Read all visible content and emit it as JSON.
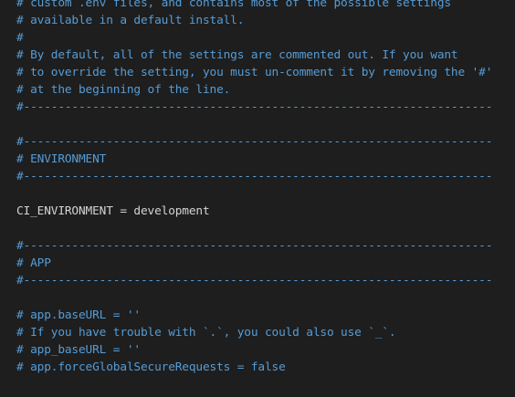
{
  "editor": {
    "language": "dotenv",
    "colors": {
      "background": "#1e1e1e",
      "comment": "#569cd6",
      "text": "#d4d4d4"
    },
    "lines": [
      {
        "kind": "comment",
        "text": "# custom .env files, and contains most of the possible settings"
      },
      {
        "kind": "comment",
        "text": "# available in a default install."
      },
      {
        "kind": "comment",
        "text": "#"
      },
      {
        "kind": "comment",
        "text": "# By default, all of the settings are commented out. If you want"
      },
      {
        "kind": "comment",
        "text": "# to override the setting, you must un-comment it by removing the '#'"
      },
      {
        "kind": "comment",
        "text": "# at the beginning of the line."
      },
      {
        "kind": "comment",
        "text": "#--------------------------------------------------------------------"
      },
      {
        "kind": "blank",
        "text": ""
      },
      {
        "kind": "comment",
        "text": "#--------------------------------------------------------------------"
      },
      {
        "kind": "comment",
        "text": "# ENVIRONMENT"
      },
      {
        "kind": "comment",
        "text": "#--------------------------------------------------------------------"
      },
      {
        "kind": "blank",
        "text": ""
      },
      {
        "kind": "plain",
        "text": "CI_ENVIRONMENT = development"
      },
      {
        "kind": "blank",
        "text": ""
      },
      {
        "kind": "comment",
        "text": "#--------------------------------------------------------------------"
      },
      {
        "kind": "comment",
        "text": "# APP"
      },
      {
        "kind": "comment",
        "text": "#--------------------------------------------------------------------"
      },
      {
        "kind": "blank",
        "text": ""
      },
      {
        "kind": "comment",
        "text": "# app.baseURL = ''"
      },
      {
        "kind": "comment",
        "text": "# If you have trouble with `.`, you could also use `_`."
      },
      {
        "kind": "comment",
        "text": "# app_baseURL = ''"
      },
      {
        "kind": "comment",
        "text": "# app.forceGlobalSecureRequests = false"
      }
    ]
  }
}
